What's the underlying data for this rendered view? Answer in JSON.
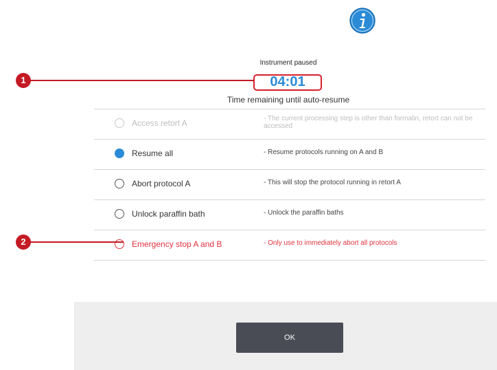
{
  "dialog": {
    "title": "Instrument paused",
    "timer": "04:01",
    "subtitle": "Time remaining until auto-resume",
    "ok_label": "OK",
    "colors": {
      "accent": "#2b8bd6",
      "danger": "#e0323d",
      "callout": "#c41a24",
      "button": "#4a4c55",
      "footer": "#eeeeee"
    }
  },
  "options": [
    {
      "label": "Access retort A",
      "description": "- The current processing step is other than formalin, retort can not be accessed",
      "state": "disabled"
    },
    {
      "label": "Resume all",
      "description": "- Resume protocols running on A and B",
      "state": "selected"
    },
    {
      "label": "Abort protocol A",
      "description": "- This will stop the protocol running in retort A",
      "state": "normal"
    },
    {
      "label": "Unlock paraffin bath",
      "description": "- Unlock the paraffin baths",
      "state": "normal"
    },
    {
      "label": "Emergency stop A and B",
      "description": "- Only use to immediately abort all protocols",
      "state": "danger"
    }
  ],
  "callouts": [
    {
      "number": "1"
    },
    {
      "number": "2"
    }
  ],
  "icons": {
    "info": "info-icon"
  }
}
